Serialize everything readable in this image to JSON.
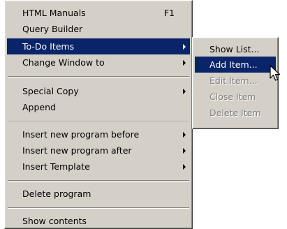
{
  "main_menu": {
    "items": [
      {
        "label": "HTML Manuals",
        "shortcut": "F1"
      },
      {
        "label": "Query Builder"
      },
      {
        "label": "To-Do Items"
      },
      {
        "label": "Change Window to"
      },
      {
        "label": "Special Copy"
      },
      {
        "label": "Append"
      },
      {
        "label": "Insert new program before"
      },
      {
        "label": "Insert new program after"
      },
      {
        "label": "Insert Template"
      },
      {
        "label": "Delete program"
      },
      {
        "label": "Show contents"
      }
    ]
  },
  "submenu": {
    "items": [
      {
        "label": "Show List..."
      },
      {
        "label": "Add Item..."
      },
      {
        "label": "Edit Item..."
      },
      {
        "label": "Close Item"
      },
      {
        "label": "Delete Item"
      }
    ]
  },
  "colors": {
    "menu_bg": "#d4d0c8",
    "highlight": "#0a246a",
    "disabled_text": "#808080"
  },
  "icons": {
    "submenu_arrow": "triangle-right",
    "cursor": "arrow-pointer"
  }
}
